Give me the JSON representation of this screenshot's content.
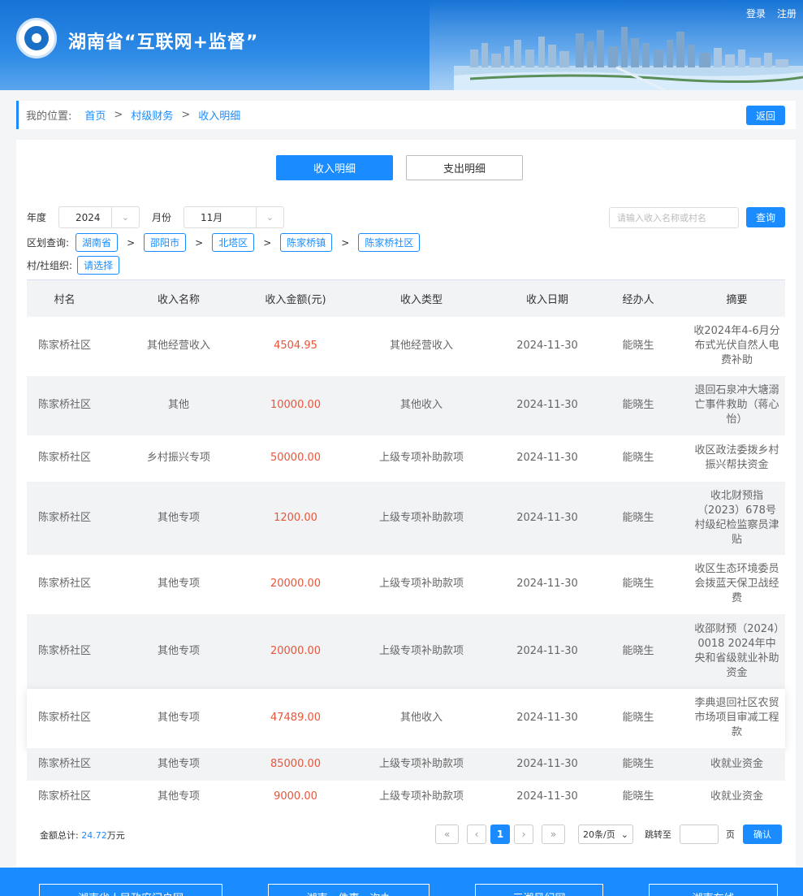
{
  "header": {
    "site_title": "湖南省“互联网+监督”",
    "login": "登录",
    "register": "注册"
  },
  "breadcrumb": {
    "label": "我的位置:",
    "items": [
      "首页",
      "村级财务",
      "收入明细"
    ],
    "back": "返回"
  },
  "tabs": [
    {
      "label": "收入明细",
      "active": true
    },
    {
      "label": "支出明细",
      "active": false
    }
  ],
  "filters": {
    "year_label": "年度",
    "year_value": "2024",
    "month_label": "月份",
    "month_value": "11月",
    "search_placeholder": "请输入收入名称或村名",
    "query_button": "查询",
    "region_label": "区划查询:",
    "regions": [
      "湖南省",
      "邵阳市",
      "北塔区",
      "陈家桥镇",
      "陈家桥社区"
    ],
    "org_label": "村/社组织:",
    "org_button": "请选择"
  },
  "table": {
    "headers": [
      "村名",
      "收入名称",
      "收入金额(元)",
      "收入类型",
      "收入日期",
      "经办人",
      "摘要"
    ],
    "rows": [
      [
        "陈家桥社区",
        "其他经营收入",
        "4504.95",
        "其他经营收入",
        "2024-11-30",
        "能晓生",
        "收2024年4-6月分布式光伏自然人电费补助"
      ],
      [
        "陈家桥社区",
        "其他",
        "10000.00",
        "其他收入",
        "2024-11-30",
        "能晓生",
        "退回石泉冲大塘溺亡事件救助（蒋心怡）"
      ],
      [
        "陈家桥社区",
        "乡村振兴专项",
        "50000.00",
        "上级专项补助款项",
        "2024-11-30",
        "能晓生",
        "收区政法委拨乡村振兴帮扶资金"
      ],
      [
        "陈家桥社区",
        "其他专项",
        "1200.00",
        "上级专项补助款项",
        "2024-11-30",
        "能晓生",
        "收北财预指（2023）678号村级纪检监察员津贴"
      ],
      [
        "陈家桥社区",
        "其他专项",
        "20000.00",
        "上级专项补助款项",
        "2024-11-30",
        "能晓生",
        "收区生态环境委员会拨蓝天保卫战经费"
      ],
      [
        "陈家桥社区",
        "其他专项",
        "20000.00",
        "上级专项补助款项",
        "2024-11-30",
        "能晓生",
        "收邵财预（2024）0018 2024年中央和省级就业补助资金"
      ],
      [
        "陈家桥社区",
        "其他专项",
        "47489.00",
        "其他收入",
        "2024-11-30",
        "能晓生",
        "李典退回社区农贸市场项目审减工程款"
      ],
      [
        "陈家桥社区",
        "其他专项",
        "85000.00",
        "上级专项补助款项",
        "2024-11-30",
        "能晓生",
        "收就业资金"
      ],
      [
        "陈家桥社区",
        "其他专项",
        "9000.00",
        "上级专项补助款项",
        "2024-11-30",
        "能晓生",
        "收就业资金"
      ]
    ]
  },
  "summary": {
    "label": "金额总计:",
    "value": "24.72",
    "unit": "万元"
  },
  "pagination": {
    "first": "«",
    "prev": "‹",
    "current": "1",
    "next": "›",
    "last": "»",
    "page_size": "20条/页",
    "jump_label": "跳转至",
    "page_unit": "页",
    "confirm": "确认"
  },
  "footer": {
    "links": [
      "湖南省人民政府门户网",
      "湖南一件事一次办",
      "三湘风纪网",
      "湖南在线"
    ]
  },
  "colors": {
    "primary": "#1a8cff",
    "amount": "#e8553a"
  }
}
